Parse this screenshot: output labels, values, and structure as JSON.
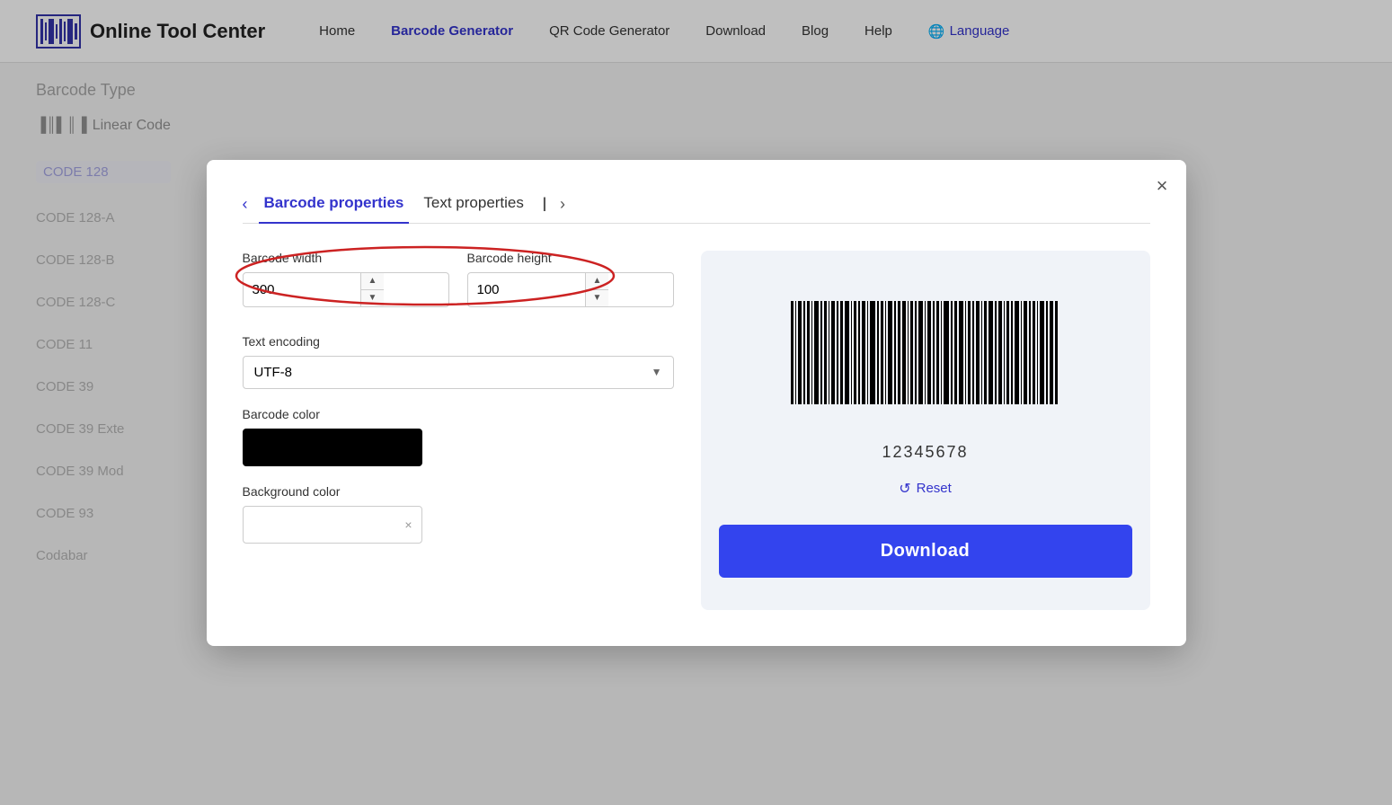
{
  "header": {
    "logo_text": "Online Tool Center",
    "nav": [
      {
        "label": "Home",
        "active": false
      },
      {
        "label": "Barcode Generator",
        "active": true
      },
      {
        "label": "QR Code Generator",
        "active": false
      },
      {
        "label": "Download",
        "active": false
      },
      {
        "label": "Blog",
        "active": false
      },
      {
        "label": "Help",
        "active": false
      },
      {
        "label": "Language",
        "active": false
      }
    ]
  },
  "background": {
    "sidebar_label": "Barcode Type",
    "linear_label": "Linear Code",
    "items": [
      {
        "label": "CODE 128",
        "active": true
      },
      {
        "label": "CODE 128-A",
        "active": false
      },
      {
        "label": "CODE 128-B",
        "active": false
      },
      {
        "label": "CODE 128-C",
        "active": false
      },
      {
        "label": "CODE 11",
        "active": false
      },
      {
        "label": "CODE 39",
        "active": false
      },
      {
        "label": "CODE 39 Exte",
        "active": false
      },
      {
        "label": "CODE 39 Mod",
        "active": false
      },
      {
        "label": "CODE 93",
        "active": false
      },
      {
        "label": "Codabar",
        "active": false
      }
    ]
  },
  "modal": {
    "tabs": [
      {
        "label": "Barcode properties",
        "active": true
      },
      {
        "label": "Text properties",
        "active": false
      }
    ],
    "close_label": "×",
    "barcode_width_label": "Barcode width",
    "barcode_width_value": "300",
    "barcode_height_label": "Barcode height",
    "barcode_height_value": "100",
    "text_encoding_label": "Text encoding",
    "text_encoding_value": "UTF-8",
    "barcode_color_label": "Barcode color",
    "background_color_label": "Background color",
    "reset_label": "Reset",
    "download_label": "Download",
    "barcode_number": "12345678"
  }
}
